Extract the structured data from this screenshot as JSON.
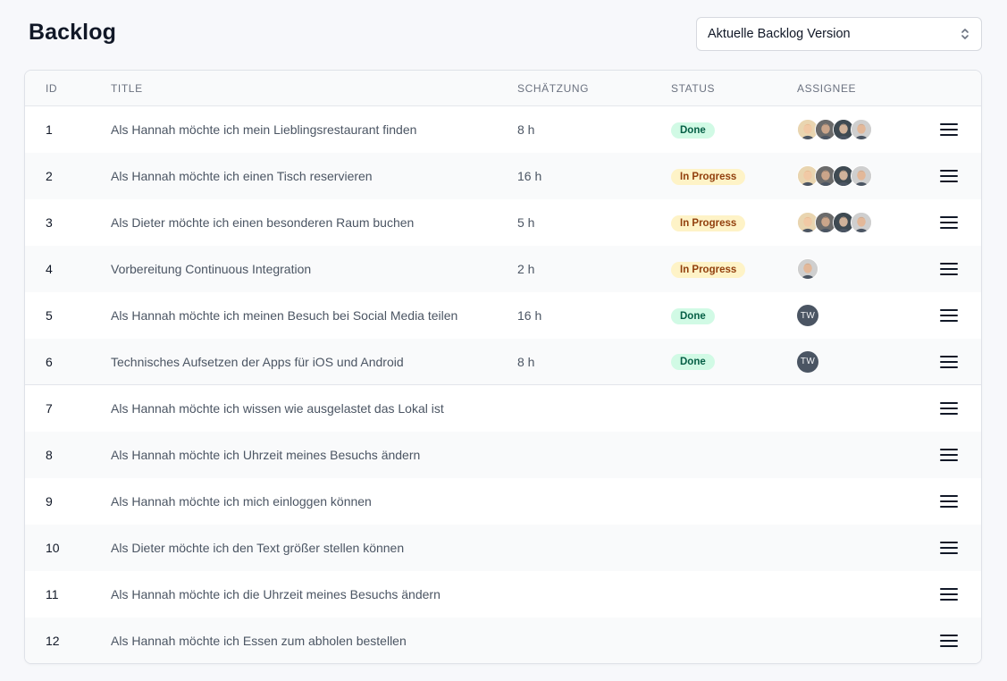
{
  "page": {
    "title": "Backlog"
  },
  "version_select": {
    "value": "Aktuelle Backlog Version"
  },
  "table": {
    "headers": {
      "id": "ID",
      "title": "TITLE",
      "estimate": "SCHÄTZUNG",
      "status": "STATUS",
      "assignee": "ASSIGNEE"
    },
    "rows": [
      {
        "id": "1",
        "title": "Als Hannah möchte ich mein Lieblingsrestaurant finden",
        "estimate": "8 h",
        "status": "Done",
        "assignees": [
          "photo-a",
          "photo-b",
          "photo-c",
          "photo-d"
        ]
      },
      {
        "id": "2",
        "title": "Als Hannah möchte ich einen Tisch reservieren",
        "estimate": "16 h",
        "status": "In Progress",
        "assignees": [
          "photo-a",
          "photo-b",
          "photo-c",
          "photo-d"
        ]
      },
      {
        "id": "3",
        "title": "Als Dieter möchte ich einen besonderen Raum buchen",
        "estimate": "5 h",
        "status": "In Progress",
        "assignees": [
          "photo-a",
          "photo-b",
          "photo-c",
          "photo-d"
        ]
      },
      {
        "id": "4",
        "title": "Vorbereitung Continuous Integration",
        "estimate": "2 h",
        "status": "In Progress",
        "assignees": [
          "photo-d"
        ]
      },
      {
        "id": "5",
        "title": "Als Hannah möchte ich meinen Besuch bei Social Media teilen",
        "estimate": "16 h",
        "status": "Done",
        "assignees": [
          "TW"
        ]
      },
      {
        "id": "6",
        "title": "Technisches Aufsetzen der Apps für iOS und Android",
        "estimate": "8 h",
        "status": "Done",
        "assignees": [
          "TW"
        ]
      },
      {
        "id": "7",
        "title": "Als Hannah möchte ich wissen wie ausgelastet das Lokal ist",
        "estimate": "",
        "status": "",
        "assignees": []
      },
      {
        "id": "8",
        "title": "Als Hannah möchte ich Uhrzeit meines Besuchs ändern",
        "estimate": "",
        "status": "",
        "assignees": []
      },
      {
        "id": "9",
        "title": "Als Hannah möchte ich mich einloggen können",
        "estimate": "",
        "status": "",
        "assignees": []
      },
      {
        "id": "10",
        "title": "Als Dieter möchte ich den Text größer stellen können",
        "estimate": "",
        "status": "",
        "assignees": []
      },
      {
        "id": "11",
        "title": "Als Hannah möchte ich die Uhrzeit meines Besuchs ändern",
        "estimate": "",
        "status": "",
        "assignees": []
      },
      {
        "id": "12",
        "title": "Als Hannah möchte ich Essen zum abholen bestellen",
        "estimate": "",
        "status": "",
        "assignees": []
      }
    ]
  },
  "status_colors": {
    "Done": {
      "bg": "#d1fae5",
      "fg": "#065f46"
    },
    "In Progress": {
      "bg": "#fef3c7",
      "fg": "#92400e"
    }
  },
  "icons": {
    "select": "chevron-up-down-icon",
    "row_menu": "hamburger-menu-icon"
  }
}
